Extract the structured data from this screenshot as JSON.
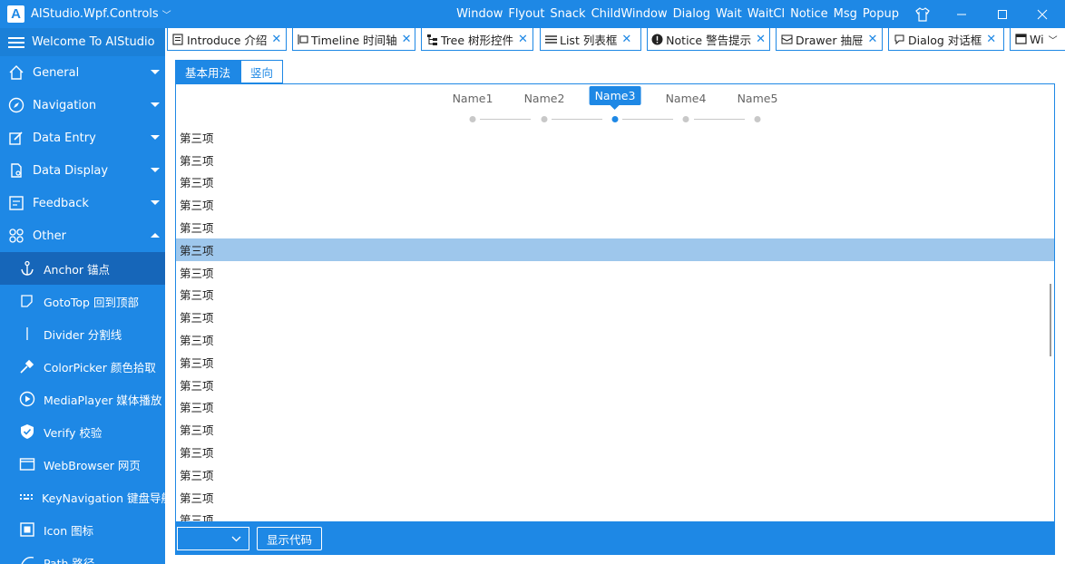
{
  "window": {
    "title": "AIStudio.Wpf.Controls",
    "menu": [
      "Window",
      "Flyout",
      "Snack",
      "ChildWindow",
      "Dialog",
      "Wait",
      "WaitCl",
      "Notice",
      "Msg",
      "Popup"
    ]
  },
  "sidebar": {
    "welcome": "Welcome To AIStudio",
    "groups": [
      {
        "label": "General",
        "icon": "home-icon"
      },
      {
        "label": "Navigation",
        "icon": "compass-icon"
      },
      {
        "label": "Data Entry",
        "icon": "edit-icon"
      },
      {
        "label": "Data Display",
        "icon": "document-icon"
      },
      {
        "label": "Feedback",
        "icon": "feedback-icon"
      },
      {
        "label": "Other",
        "icon": "apps-icon"
      }
    ],
    "items": [
      {
        "label": "Anchor 锚点",
        "icon": "anchor-icon"
      },
      {
        "label": "GotoTop 回到顶部",
        "icon": "goto-top-icon"
      },
      {
        "label": "Divider 分割线",
        "icon": "divider-icon"
      },
      {
        "label": "ColorPicker 颜色拾取",
        "icon": "eyedropper-icon"
      },
      {
        "label": "MediaPlayer 媒体播放",
        "icon": "play-icon"
      },
      {
        "label": "Verify 校验",
        "icon": "shield-icon"
      },
      {
        "label": "WebBrowser 网页",
        "icon": "browser-icon"
      },
      {
        "label": "KeyNavigation 键盘导航",
        "icon": "keyboard-icon"
      },
      {
        "label": "Icon 图标",
        "icon": "image-icon"
      },
      {
        "label": "Path 路径",
        "icon": "path-icon"
      }
    ]
  },
  "tabs": [
    {
      "label": "Introduce 介绍",
      "icon": "doc-icon"
    },
    {
      "label": "Timeline 时间轴",
      "icon": "timeline-icon"
    },
    {
      "label": "Tree 树形控件",
      "icon": "tree-icon"
    },
    {
      "label": "List 列表框",
      "icon": "list-icon"
    },
    {
      "label": "Notice 警告提示",
      "icon": "alert-icon"
    },
    {
      "label": "Drawer 抽屉",
      "icon": "drawer-icon"
    },
    {
      "label": "Dialog 对话框",
      "icon": "dialog-icon"
    },
    {
      "label": "Wi",
      "icon": "window-icon"
    }
  ],
  "subtabs": [
    "基本用法",
    "竖向"
  ],
  "steps": [
    "Name1",
    "Name2",
    "Name3",
    "Name4",
    "Name5"
  ],
  "active_step": "Name3",
  "list": {
    "items": [
      "第三项",
      "第三项",
      "第三项",
      "第三项",
      "第三项",
      "第三项",
      "第三项",
      "第三项",
      "第三项",
      "第三项",
      "第三项",
      "第三项",
      "第三项",
      "第三项",
      "第三项",
      "第三项",
      "第三项",
      "第三项"
    ],
    "selected_index": 5
  },
  "bottombar": {
    "combo_value": "",
    "show_code": "显示代码"
  },
  "colors": {
    "accent": "#1e88e5",
    "selected_row": "#9ec7ec",
    "sidebar_active": "#1666b9"
  }
}
